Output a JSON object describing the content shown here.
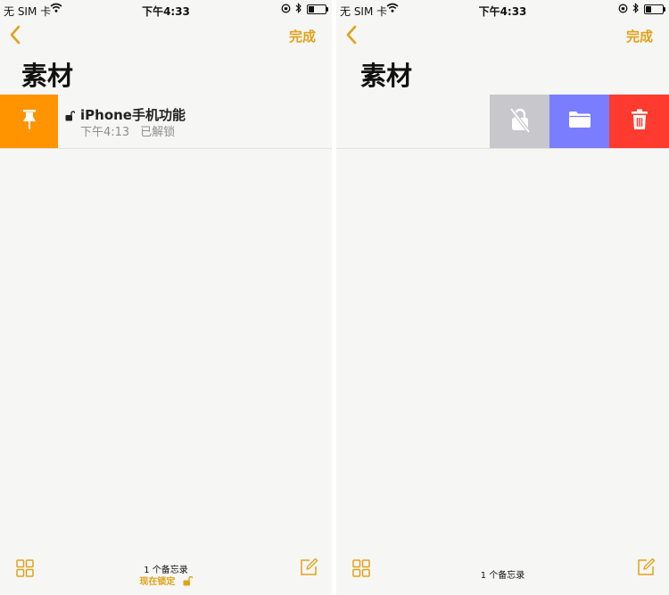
{
  "status_bar": {
    "carrier": "无 SIM 卡",
    "time": "下午4:33"
  },
  "nav": {
    "done_label": "完成"
  },
  "folder_title": "素材",
  "note": {
    "title": "iPhone手机功能",
    "time": "下午4:13",
    "status": "已解锁"
  },
  "toolbar": {
    "note_count": "1 个备忘录",
    "lock_now": "现在锁定"
  },
  "colors": {
    "accent": "#e0a21b",
    "pin": "#ff9400",
    "unlock": "#c7c7cc",
    "move": "#7b7dff",
    "delete": "#ff3b30"
  }
}
